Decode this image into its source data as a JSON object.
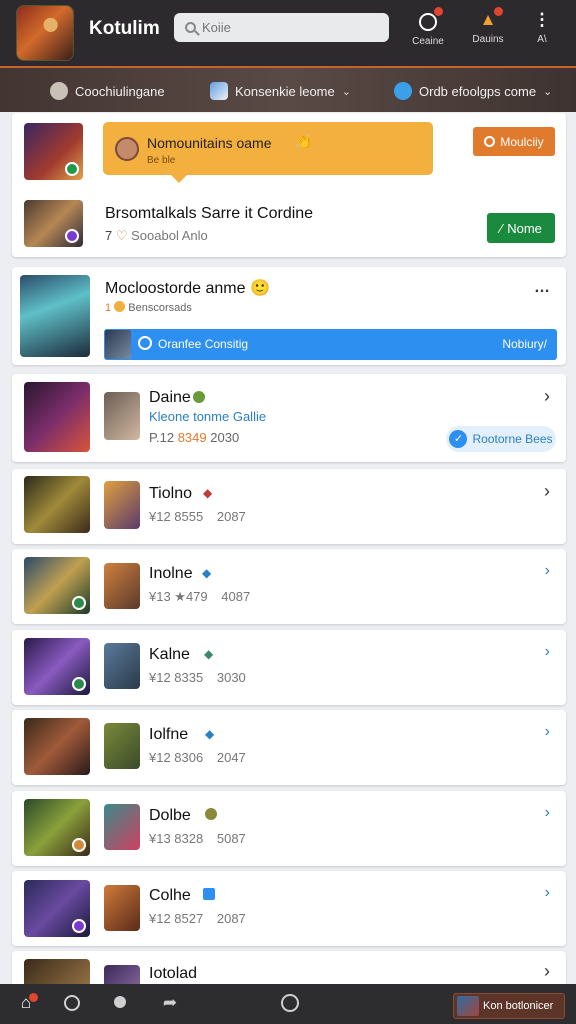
{
  "header": {
    "app_title": "Kotulim",
    "search": {
      "value": "",
      "placeholder": "Koiie"
    },
    "icons": [
      {
        "label": "Ceaine",
        "badge": "1",
        "icon": "notification-icon"
      },
      {
        "label": "Dauins",
        "badge": "1",
        "icon": "trophy-icon"
      },
      {
        "label": "A\\",
        "icon": "more-vertical-icon"
      }
    ]
  },
  "subnav": [
    {
      "label": "Coochiulingane",
      "icon": "hand-icon"
    },
    {
      "label": "Konsenkie leome",
      "icon": "wand-icon"
    },
    {
      "label": "Ordb efoolgps come",
      "icon": "chat-icon"
    }
  ],
  "top_card": {
    "bubble": {
      "text": "Nomounitains oame",
      "sub": "Be ble",
      "emoji": "👏"
    },
    "bubble_button": "Moulciiy",
    "row": {
      "name": "Brsomtalkals Sarre it Cordine",
      "rank": "7",
      "sub": "Sooabol Anlo"
    },
    "row_button": "Nome"
  },
  "feature_card": {
    "title": "Mocloostorde anme 🙂",
    "count": "1",
    "sub": "Benscorsads",
    "bar_left": "Oranfee Consitig",
    "bar_right": "Nobiury/"
  },
  "list": [
    {
      "name": "Daine",
      "tag": "Kleone tonme Gallie",
      "stats": "P.12",
      "stat_hi": "8349",
      "year": "2030",
      "pill": "Rootorne Bees"
    },
    {
      "name": "Tiolno",
      "stats": "¥12 8555",
      "year": "2087"
    },
    {
      "name": "Inolne",
      "stats": "¥13 ★479",
      "year": "4087"
    },
    {
      "name": "Kalne",
      "stats": "¥12 8335",
      "year": "3030"
    },
    {
      "name": "Iolfne",
      "stats": "¥12 8306",
      "year": "2047"
    },
    {
      "name": "Dolbe",
      "stats": "¥13 8328",
      "year": "5087"
    },
    {
      "name": "Colhe",
      "stats": "¥12 8527",
      "year": "2087"
    },
    {
      "name": "Iotolad"
    }
  ],
  "bottom_nav": {
    "button": "Kon botlonicer",
    "items": [
      "home-icon",
      "circle-icon",
      "profile-icon",
      "share-icon",
      "clock-icon"
    ]
  },
  "colors": {
    "accent_orange": "#e07a2c",
    "green_button": "#1a8a3f",
    "blue_bar": "#2d8ff0",
    "topbar": "#2c2a2c"
  }
}
